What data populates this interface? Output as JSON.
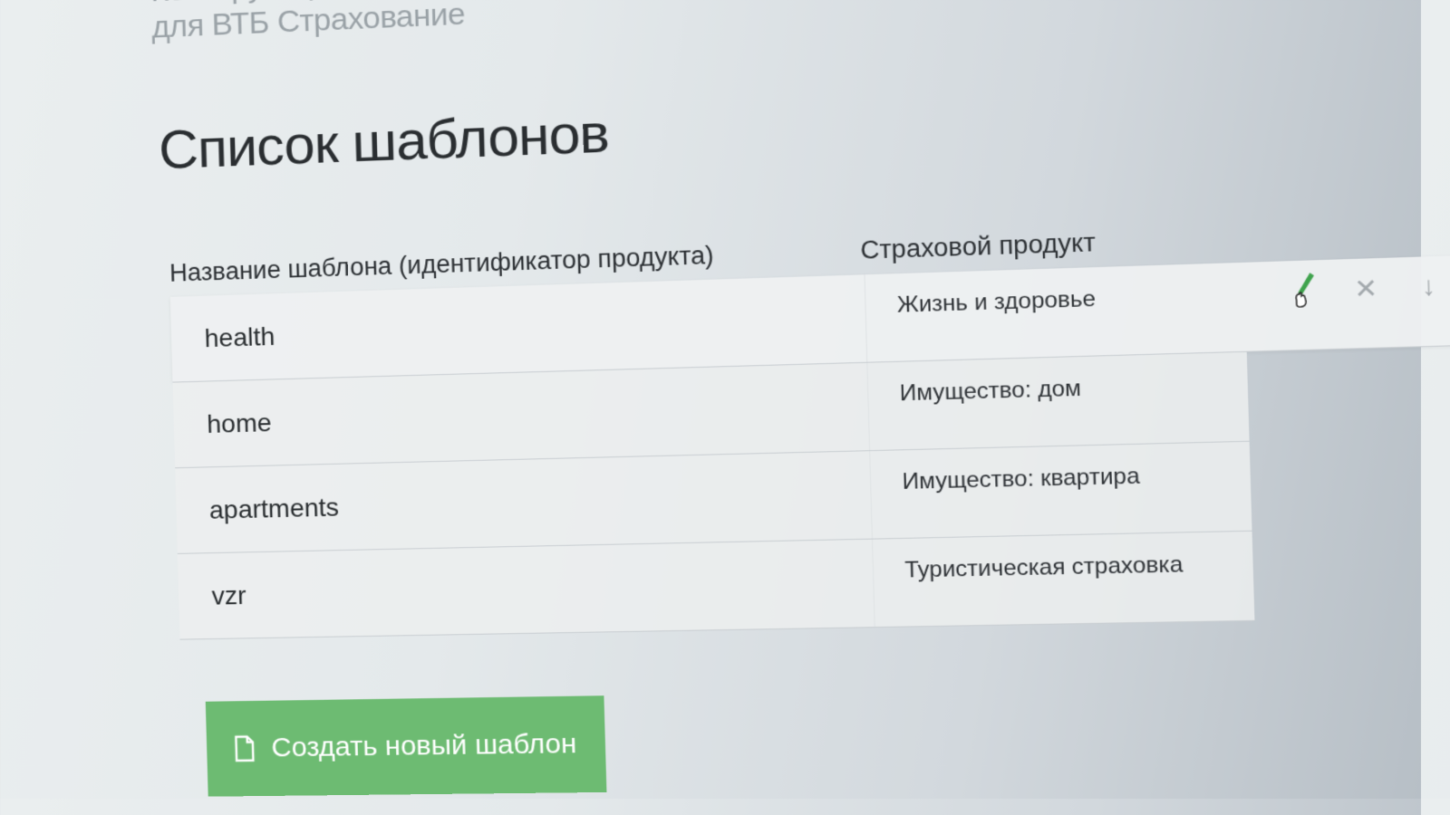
{
  "header": {
    "app_name_line1": "Конструктор Passbook",
    "app_name_line2": "для ВТБ Страхование"
  },
  "page_title": "Список шаблонов",
  "table": {
    "columns": [
      "Название шаблона (идентификатор продукта)",
      "Страховой продукт"
    ],
    "rows": [
      {
        "name": "health",
        "product": "Жизнь и здоровье"
      },
      {
        "name": "home",
        "product": "Имущество: дом"
      },
      {
        "name": "apartments",
        "product": "Имущество: квартира"
      },
      {
        "name": "vzr",
        "product": "Туристическая страховка"
      }
    ],
    "row_actions": {
      "edit_icon": "pencil-icon",
      "delete_icon": "close-icon",
      "download_icon": "arrow-down-icon",
      "delete_glyph": "✕",
      "download_glyph": "↓"
    }
  },
  "create_button": {
    "label": "Создать новый шаблон",
    "icon": "document-icon"
  },
  "colors": {
    "accent_green": "#6dbb72",
    "edit_green": "#3fa34d",
    "text_dark": "#2a2e31",
    "header_gray": "#9aa2a7"
  }
}
